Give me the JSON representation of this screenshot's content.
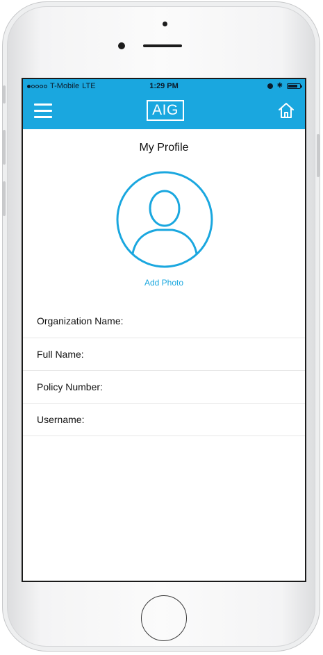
{
  "status_bar": {
    "carrier": "T-Mobile",
    "network": "LTE",
    "time": "1:29 PM"
  },
  "app_bar": {
    "logo_text": "AIG",
    "menu_icon": "hamburger-menu-icon",
    "home_icon": "home-icon"
  },
  "profile": {
    "title": "My Profile",
    "add_photo_label": "Add Photo",
    "avatar_icon": "user-avatar-icon"
  },
  "fields": [
    {
      "label": "Organization Name:"
    },
    {
      "label": "Full Name:"
    },
    {
      "label": "Policy Number:"
    },
    {
      "label": "Username:"
    }
  ],
  "colors": {
    "accent": "#1aa7df",
    "text": "#111111",
    "divider": "#e6e6e6"
  }
}
